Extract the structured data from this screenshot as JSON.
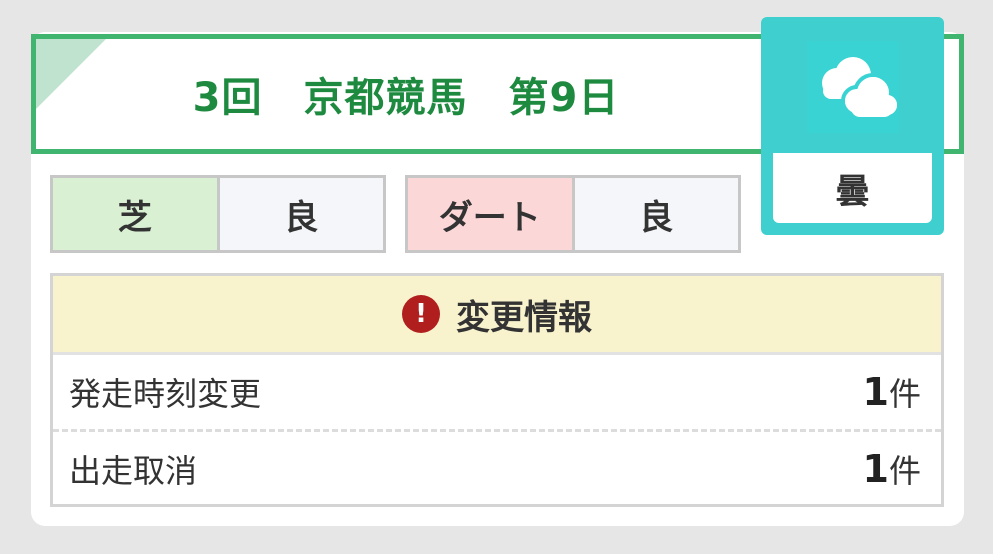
{
  "race": {
    "title": "3回　京都競馬　第9日"
  },
  "weather": {
    "icon": "cloud-icon",
    "label": "曇"
  },
  "track_condition": {
    "turf_label": "芝",
    "turf_value": "良",
    "dirt_label": "ダート",
    "dirt_value": "良"
  },
  "changes": {
    "header_title": "変更情報",
    "alert_icon_glyph": "!",
    "rows": [
      {
        "label": "発走時刻変更",
        "count": "1",
        "unit": "件"
      },
      {
        "label": "出走取消",
        "count": "1",
        "unit": "件"
      }
    ]
  },
  "colors": {
    "accent_green": "#3fb56f",
    "title_green": "#1d8a3f",
    "weather_teal": "#3fcfcf",
    "alert_red": "#b01e1e",
    "changes_header_bg": "#f8f2cd"
  }
}
